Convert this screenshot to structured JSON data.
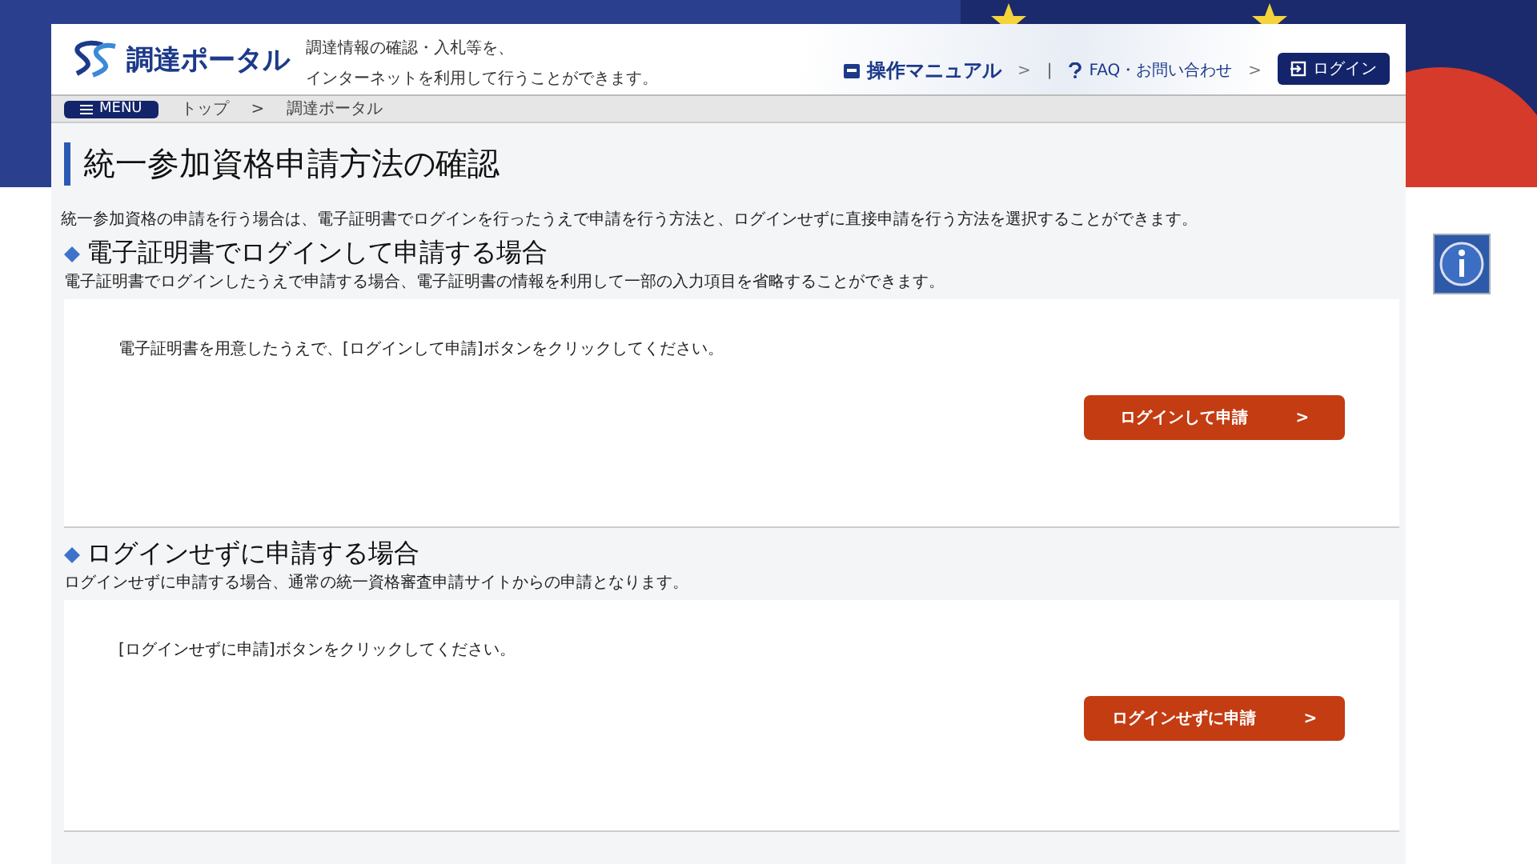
{
  "header": {
    "logo_text": "調達ポータル",
    "tagline": [
      "調達情報の確認・入札等を、",
      "インターネットを利用して行うことができます。"
    ],
    "links": [
      {
        "label": "操作マニュアル",
        "arrow": ">",
        "kind": "manual"
      },
      {
        "label": "FAQ・お問い合わせ",
        "arrow": ">",
        "kind": "faq"
      }
    ],
    "separator": "|",
    "login_button": "ログイン"
  },
  "nav": {
    "menu_button": "MENU",
    "breadcrumb": [
      "トップ",
      "調達ポータル"
    ],
    "breadcrumb_separator": ">"
  },
  "page_title": "統一参加資格申請方法の確認",
  "intro": "統一参加資格の申請を行う場合は、電子証明書でログインを行ったうえで申請を行う方法と、ログインせずに直接申請を行う方法を選択することができます。",
  "sections": [
    {
      "heading": "電子証明書でログインして申請する場合",
      "description": "電子証明書でログインしたうえで申請する場合、電子証明書の情報を利用して一部の入力項目を省略することができます。",
      "instruction": "電子証明書を用意したうえで、[ログインして申請]ボタンをクリックしてください。",
      "button": "ログインして申請",
      "button_arrow": ">"
    },
    {
      "heading": "ログインせずに申請する場合",
      "description": "ログインせずに申請する場合、通常の統一資格審査申請サイトからの申請となります。",
      "instruction": "[ログインせずに申請]ボタンをクリックしてください。",
      "button": "ログインせずに申請",
      "button_arrow": ">"
    }
  ]
}
